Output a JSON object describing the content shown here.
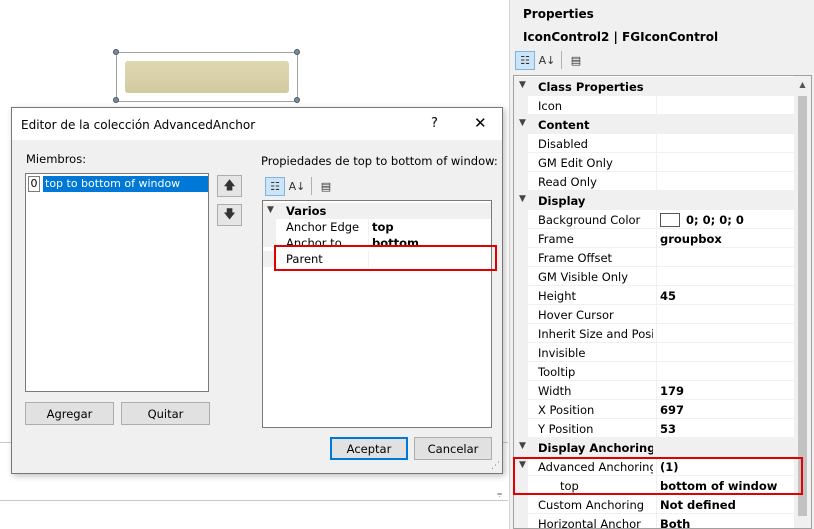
{
  "properties_panel": {
    "title": "Properties",
    "object": "IconControl2 | FGIconControl",
    "rows": [
      {
        "type": "category",
        "label": "Class Properties"
      },
      {
        "type": "prop",
        "name": "Icon",
        "value": ""
      },
      {
        "type": "category",
        "label": "Content"
      },
      {
        "type": "prop",
        "name": "Disabled",
        "value": ""
      },
      {
        "type": "prop",
        "name": "GM Edit Only",
        "value": ""
      },
      {
        "type": "prop",
        "name": "Read Only",
        "value": ""
      },
      {
        "type": "category",
        "label": "Display"
      },
      {
        "type": "prop",
        "name": "Background Color",
        "value": "0; 0; 0; 0",
        "swatch": "#ffffff"
      },
      {
        "type": "prop",
        "name": "Frame",
        "value": "groupbox"
      },
      {
        "type": "prop",
        "name": "Frame Offset",
        "value": ""
      },
      {
        "type": "prop",
        "name": "GM Visible Only",
        "value": ""
      },
      {
        "type": "prop",
        "name": "Height",
        "value": "45"
      },
      {
        "type": "prop",
        "name": "Hover Cursor",
        "value": ""
      },
      {
        "type": "prop",
        "name": "Inherit Size and Position",
        "value": ""
      },
      {
        "type": "prop",
        "name": "Invisible",
        "value": ""
      },
      {
        "type": "prop",
        "name": "Tooltip",
        "value": ""
      },
      {
        "type": "prop",
        "name": "Width",
        "value": "179"
      },
      {
        "type": "prop",
        "name": "X Position",
        "value": "697"
      },
      {
        "type": "prop",
        "name": "Y Position",
        "value": "53"
      },
      {
        "type": "category",
        "label": "Display Anchoring"
      },
      {
        "type": "prop",
        "name": "Advanced Anchoring",
        "value": "(1)",
        "expandable": true
      },
      {
        "type": "subprop",
        "name": "top",
        "value": "bottom of window"
      },
      {
        "type": "prop",
        "name": "Custom Anchoring",
        "value": "Not defined"
      },
      {
        "type": "prop",
        "name": "Horizontal Anchor",
        "value": "Both"
      }
    ]
  },
  "dialog": {
    "title": "Editor de la colección AdvancedAnchor",
    "help": "?",
    "close": "✕",
    "members_label": "Miembros:",
    "members": [
      {
        "index": "0",
        "label": "top to bottom of window"
      }
    ],
    "up_arrow": "🡅",
    "down_arrow": "🡇",
    "add_button": "Agregar",
    "remove_button": "Quitar",
    "props_label": "Propiedades de top to bottom of window:",
    "grid_category": "Varios",
    "grid_rows": [
      {
        "name": "Anchor Edge",
        "value": "top"
      },
      {
        "name": "Anchor to",
        "value": "bottom"
      },
      {
        "name": "Parent",
        "value": ""
      }
    ],
    "ok_button": "Aceptar",
    "cancel_button": "Cancelar"
  },
  "highlight_color": "#e00000",
  "selection_color": "#0078d7"
}
